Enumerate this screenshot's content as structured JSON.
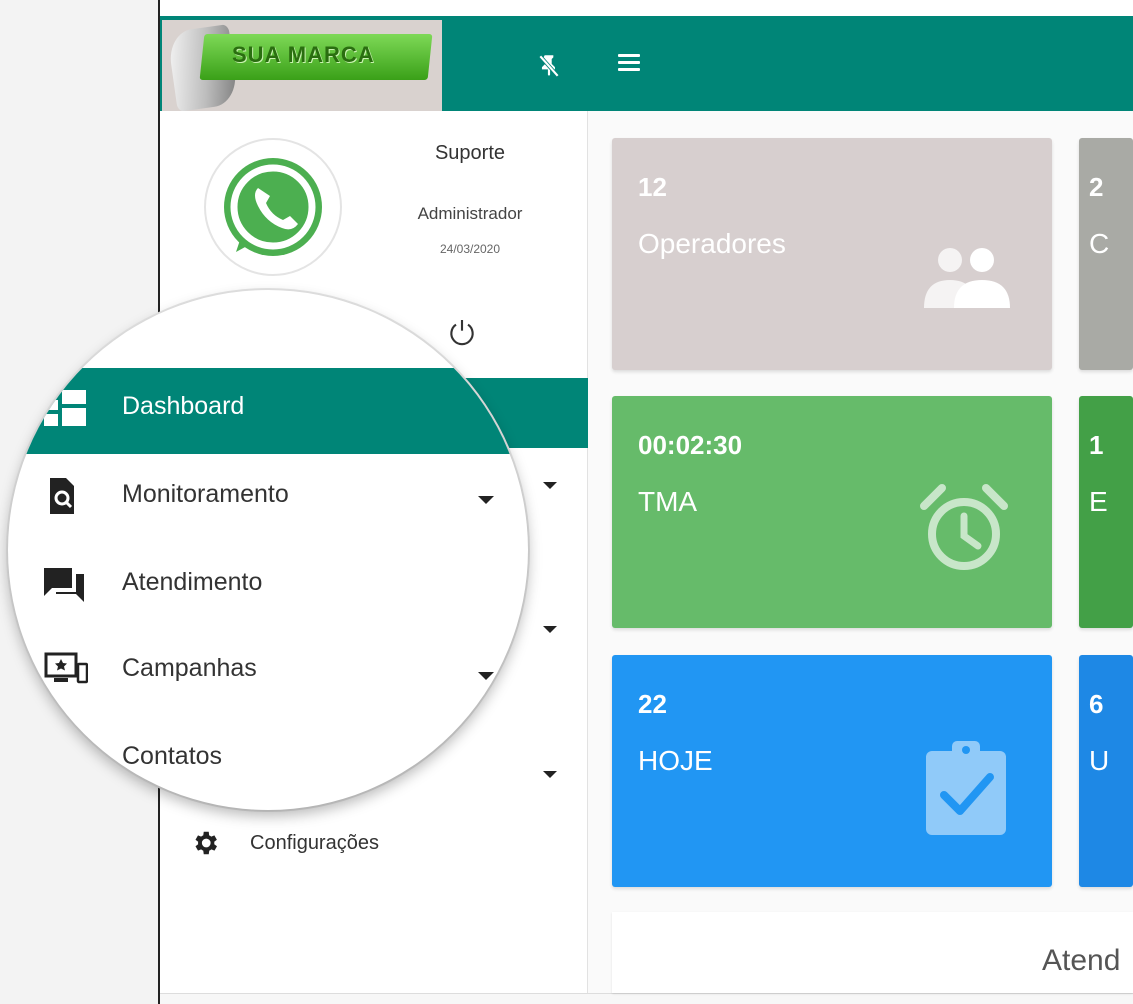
{
  "brand": {
    "logo_text": "SUA MARCA"
  },
  "profile": {
    "name": "Suporte",
    "role": "Administrador",
    "date": "24/03/2020"
  },
  "menu": {
    "items": [
      {
        "label": "Dashboard",
        "icon": "dashboard-icon",
        "active": true
      },
      {
        "label": "Monitoramento",
        "icon": "monitor-search-icon"
      },
      {
        "label": "Atendimento",
        "icon": "chat-bubbles-icon"
      },
      {
        "label": "Campanhas",
        "icon": "devices-icon"
      },
      {
        "label": "Contatos",
        "icon": "contacts-icon"
      }
    ],
    "settings_label": "Configurações"
  },
  "cards": [
    {
      "value": "12",
      "label": "Operadores",
      "color": "#d7cfcf",
      "icon": "users-icon"
    },
    {
      "value": "00:02:30",
      "label": "TMA",
      "color": "#66bb6a",
      "icon": "alarm-clock-icon"
    },
    {
      "value": "22",
      "label": "HOJE",
      "color": "#2196f3",
      "icon": "clipboard-check-icon"
    }
  ],
  "cards_peek": [
    {
      "value": "2",
      "label": "C",
      "color": "#a9aaa5"
    },
    {
      "value": "1",
      "label": "E",
      "color": "#43a047"
    },
    {
      "value": "6",
      "label": "U",
      "color": "#1e88e5"
    }
  ],
  "panel": {
    "title": "Atend"
  },
  "colors": {
    "primary": "#008577"
  }
}
